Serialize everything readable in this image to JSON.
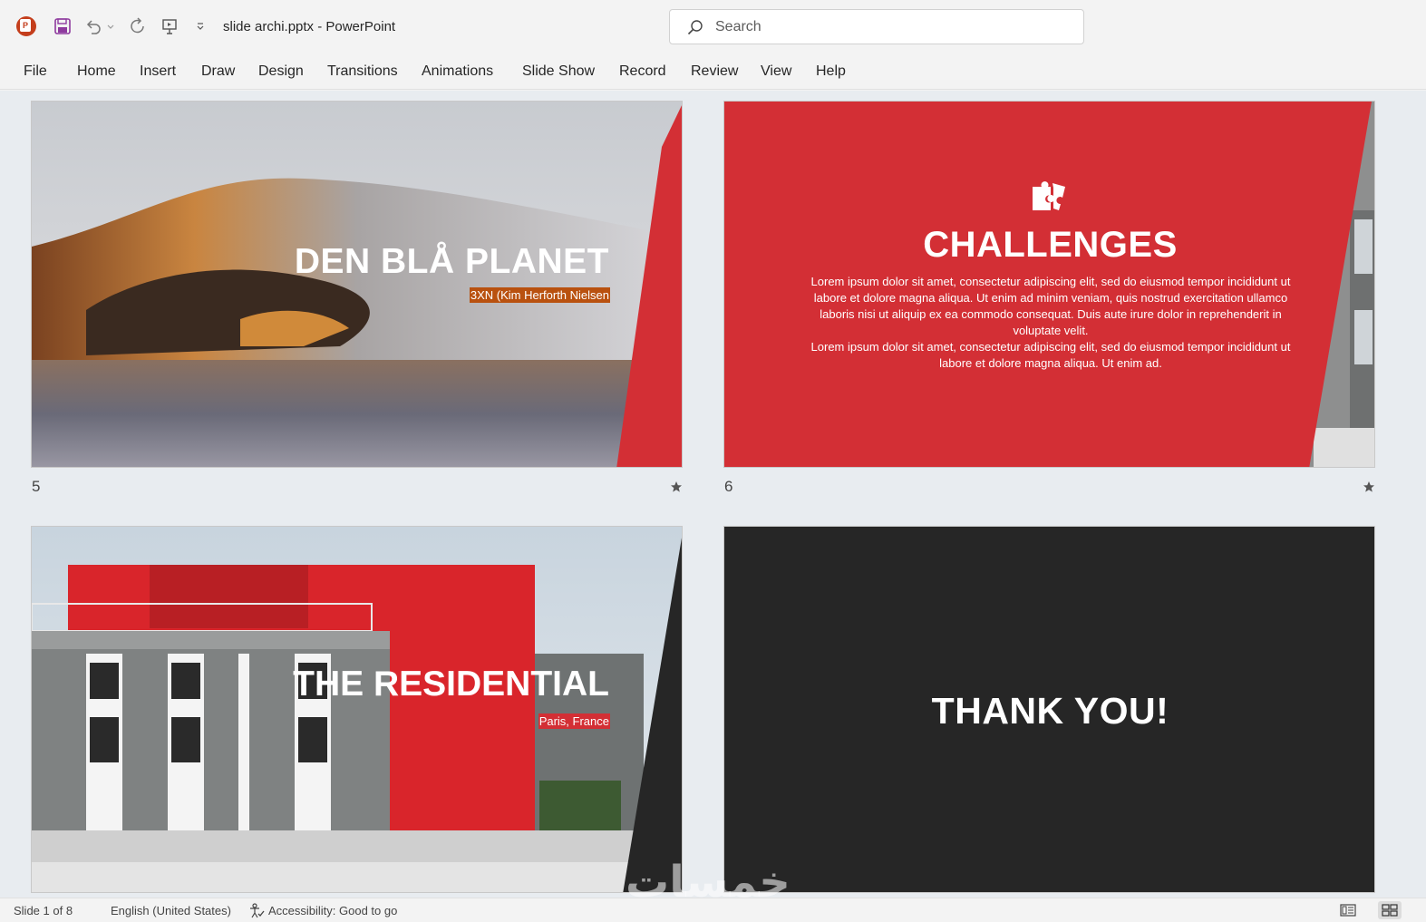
{
  "titlebar": {
    "doc_title": "slide archi.pptx  -  PowerPoint",
    "search_placeholder": "Search"
  },
  "tabs": [
    "File",
    "Home",
    "Insert",
    "Draw",
    "Design",
    "Transitions",
    "Animations",
    "Slide Show",
    "Record",
    "Review",
    "View",
    "Help"
  ],
  "slides": [
    {
      "number": "5",
      "title": "DEN BLÅ PLANET",
      "subtitle": "3XN (Kim Herforth Nielsen"
    },
    {
      "number": "6",
      "title": "CHALLENGES",
      "body1": "Lorem ipsum dolor sit amet, consectetur adipiscing elit, sed do eiusmod tempor incididunt ut labore et dolore magna aliqua. Ut enim ad minim veniam, quis nostrud exercitation ullamco laboris nisi ut aliquip ex ea commodo consequat. Duis aute irure dolor in reprehenderit in voluptate velit.",
      "body2": "Lorem ipsum dolor sit amet, consectetur adipiscing elit, sed do eiusmod tempor incididunt ut labore et dolore magna aliqua. Ut enim ad."
    },
    {
      "title": "THE RESIDENTIAL",
      "subtitle": "Paris, France"
    },
    {
      "title": "THANK YOU!"
    }
  ],
  "watermark": "خمسات",
  "statusbar": {
    "slide_info": "Slide 1 of 8",
    "language": "English (United States)",
    "accessibility": "Accessibility: Good to go"
  },
  "colors": {
    "accent_red": "#d32f35",
    "dark": "#262626"
  }
}
